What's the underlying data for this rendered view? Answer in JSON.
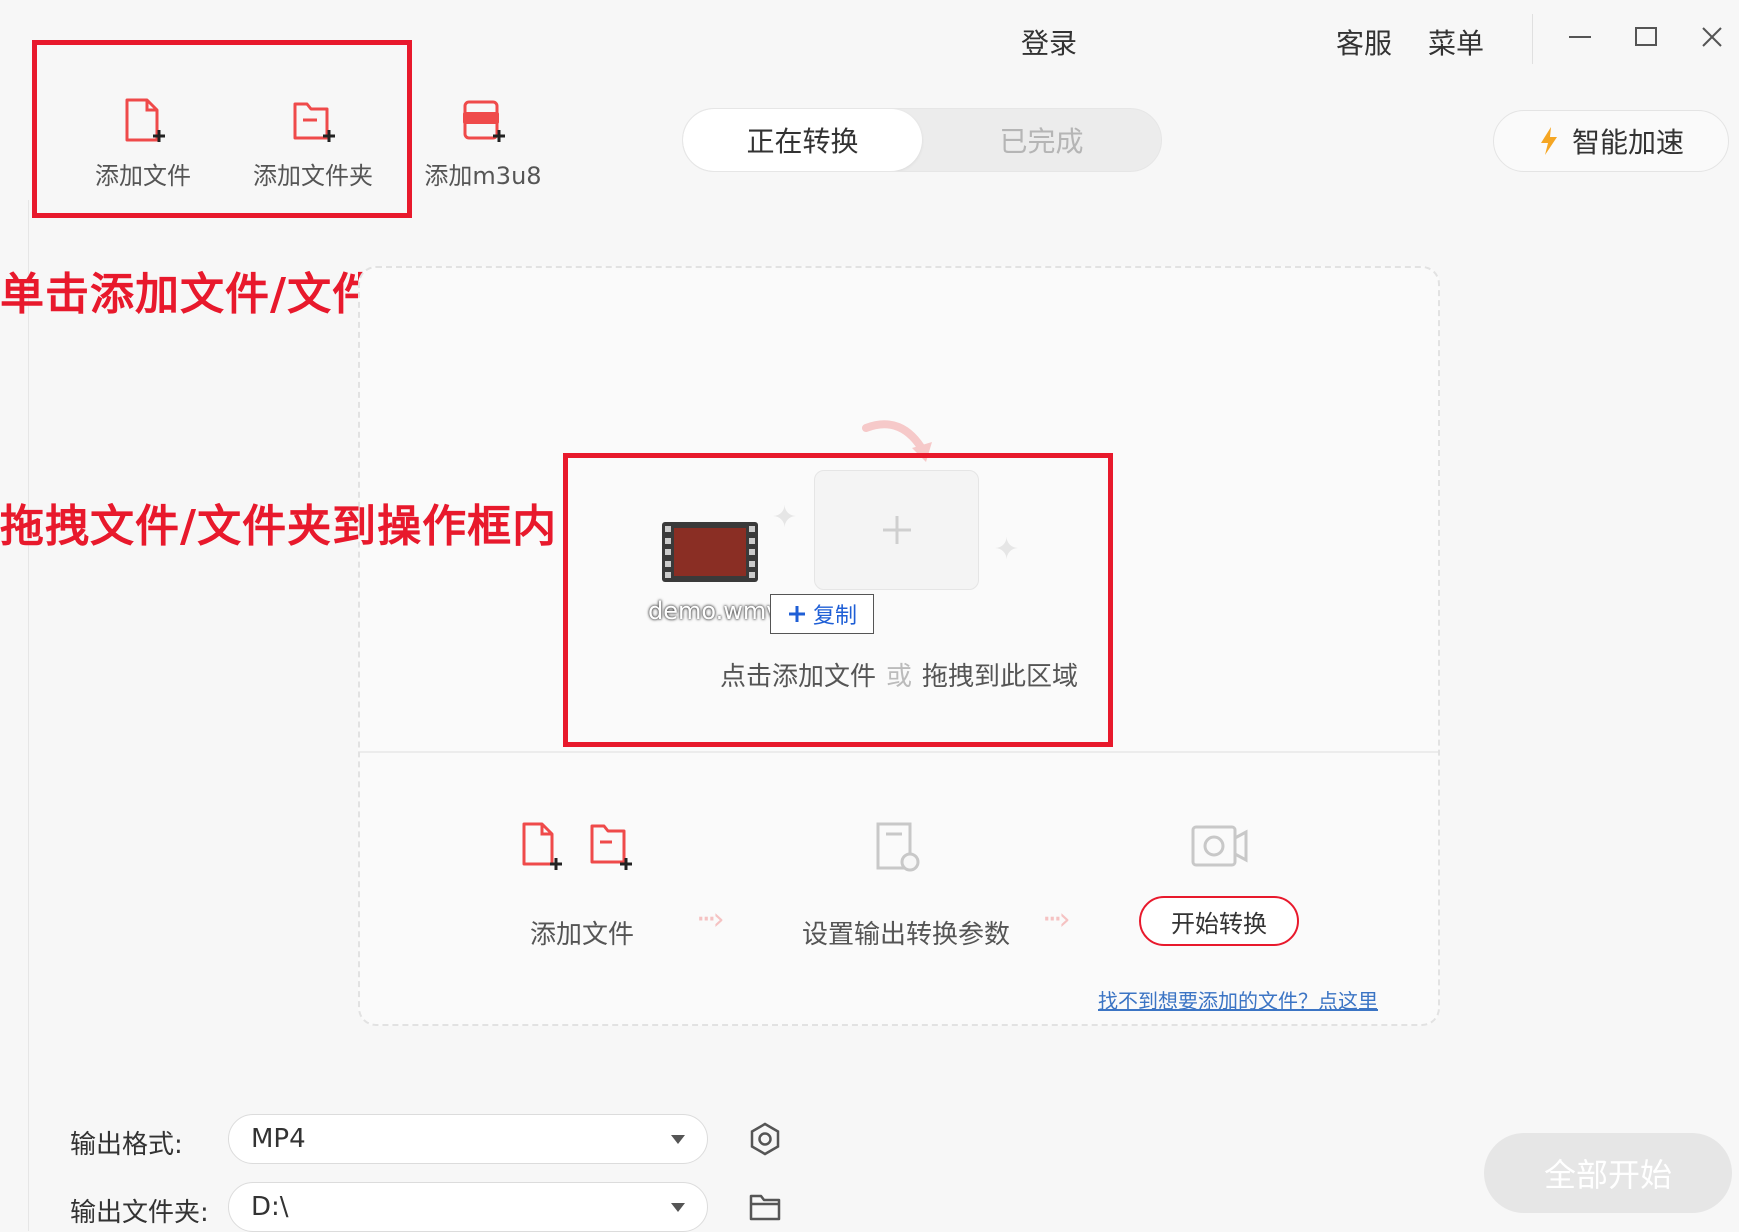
{
  "titlebar": {
    "login": "登录",
    "service": "客服",
    "menu": "菜单"
  },
  "toolbar": {
    "add_file": "添加文件",
    "add_folder": "添加文件夹",
    "add_m3u8": "添加m3u8"
  },
  "tabs": {
    "converting": "正在转换",
    "done": "已完成"
  },
  "speed_button": "智能加速",
  "annotations": {
    "click_add": "单击添加文件/文件夹",
    "drag_in": "拖拽文件/文件夹到操作框内"
  },
  "dropzone": {
    "file_name": "demo.wmv",
    "copy_badge": "复制",
    "hint_click": "点击添加文件",
    "hint_or": "或",
    "hint_drag": "拖拽到此区域"
  },
  "steps": {
    "add_file": "添加文件",
    "set_params": "设置输出转换参数",
    "start": "开始转换",
    "help_link": "找不到想要添加的文件？点这里"
  },
  "output": {
    "format_label": "输出格式:",
    "format_value": "MP4",
    "folder_label": "输出文件夹:",
    "folder_value": "D:\\"
  },
  "start_all": "全部开始",
  "colors": {
    "accent_red": "#e8192c",
    "link_blue": "#3b74c4"
  }
}
